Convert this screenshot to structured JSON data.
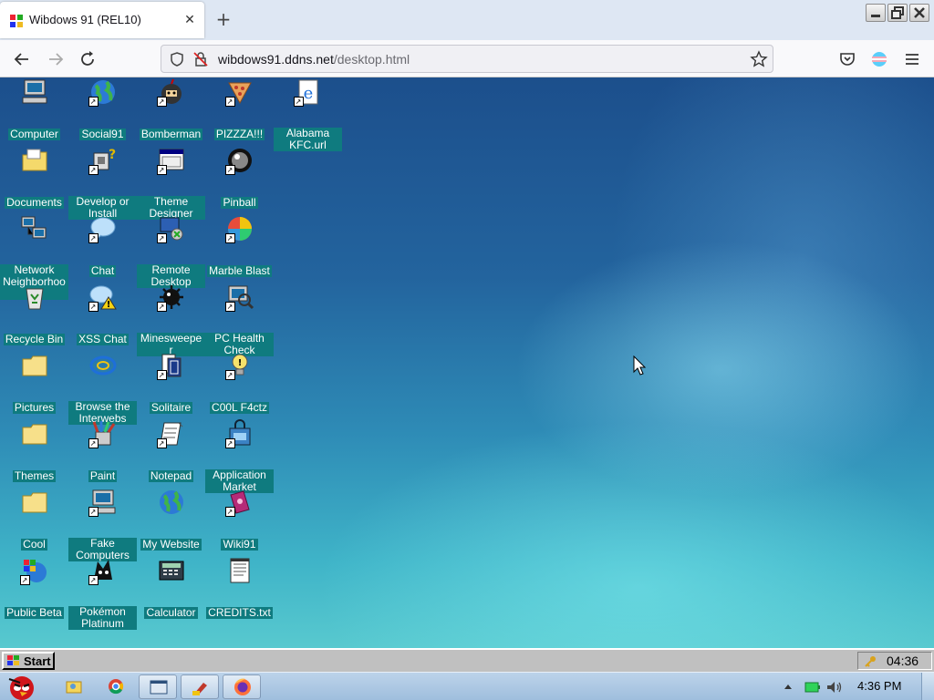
{
  "browser": {
    "tab_title": "Wibdows 91 (REL10)",
    "new_tab_symbol": "+",
    "close_symbol": "✕",
    "url_host": "wibdows91.ddns.net",
    "url_path": "/desktop.html"
  },
  "desktop": {
    "icons": [
      {
        "label": "Computer",
        "icon": "computer-icon",
        "shortcut": false
      },
      {
        "label": "Social91",
        "icon": "globe-icon",
        "shortcut": true
      },
      {
        "label": "Bomberman",
        "icon": "bomberman-icon",
        "shortcut": true
      },
      {
        "label": "PIZZZA!!!",
        "icon": "pizza-icon",
        "shortcut": true
      },
      {
        "label": "Alabama KFC.url",
        "icon": "ie-icon",
        "shortcut": true
      },
      {
        "label": "Documents",
        "icon": "documents-folder-icon",
        "shortcut": false
      },
      {
        "label": "Develop or Install",
        "icon": "develop-icon",
        "shortcut": true
      },
      {
        "label": "Theme Designer",
        "icon": "theme-designer-icon",
        "shortcut": true
      },
      {
        "label": "Pinball",
        "icon": "pinball-icon",
        "shortcut": true
      },
      {
        "label": "Network Neighborhood",
        "icon": "network-icon",
        "shortcut": false
      },
      {
        "label": "Chat",
        "icon": "chat-icon",
        "shortcut": true
      },
      {
        "label": "Remote Desktop",
        "icon": "remote-desktop-icon",
        "shortcut": true
      },
      {
        "label": "Marble Blast",
        "icon": "marble-icon",
        "shortcut": true
      },
      {
        "label": "Recycle Bin",
        "icon": "recycle-bin-icon",
        "shortcut": false
      },
      {
        "label": "XSS Chat",
        "icon": "xss-chat-icon",
        "shortcut": true
      },
      {
        "label": "Minesweeper",
        "icon": "mine-icon",
        "shortcut": true
      },
      {
        "label": "PC Health Check",
        "icon": "health-check-icon",
        "shortcut": true
      },
      {
        "label": "Pictures",
        "icon": "folder-icon",
        "shortcut": false
      },
      {
        "label": "Browse the Interwebs",
        "icon": "browser-ring-icon",
        "shortcut": false
      },
      {
        "label": "Solitaire",
        "icon": "solitaire-icon",
        "shortcut": true
      },
      {
        "label": "C00L F4ctz",
        "icon": "lightbulb-icon",
        "shortcut": true
      },
      {
        "label": "Themes",
        "icon": "folder-icon",
        "shortcut": false
      },
      {
        "label": "Paint",
        "icon": "paint-icon",
        "shortcut": true
      },
      {
        "label": "Notepad",
        "icon": "notepad-icon",
        "shortcut": true
      },
      {
        "label": "Application Market",
        "icon": "market-icon",
        "shortcut": true
      },
      {
        "label": "Cool",
        "icon": "folder-icon",
        "shortcut": false
      },
      {
        "label": "Fake Computers",
        "icon": "computer-icon",
        "shortcut": true
      },
      {
        "label": "My Website",
        "icon": "globe-icon",
        "shortcut": false
      },
      {
        "label": "Wiki91",
        "icon": "book-icon",
        "shortcut": true
      },
      {
        "label": "Public Beta",
        "icon": "windows-globe-icon",
        "shortcut": true
      },
      {
        "label": "Pokémon Platinum",
        "icon": "pokemon-icon",
        "shortcut": true
      },
      {
        "label": "Calculator",
        "icon": "calculator-icon",
        "shortcut": false
      },
      {
        "label": "CREDITS.txt",
        "icon": "text-file-icon",
        "shortcut": false
      }
    ]
  },
  "w91_taskbar": {
    "start_label": "Start",
    "clock": "04:36"
  },
  "os_taskbar": {
    "clock": "4:36 PM",
    "apps": [
      "angry-birds-icon",
      "file-explorer-icon",
      "chrome-icon",
      "app-window-icon",
      "paint-tool-icon",
      "firefox-icon"
    ]
  },
  "colors": {
    "label_bg": "#0f7b7f",
    "desktop_top": "#1c4f8c",
    "desktop_bottom": "#58c9cf"
  }
}
